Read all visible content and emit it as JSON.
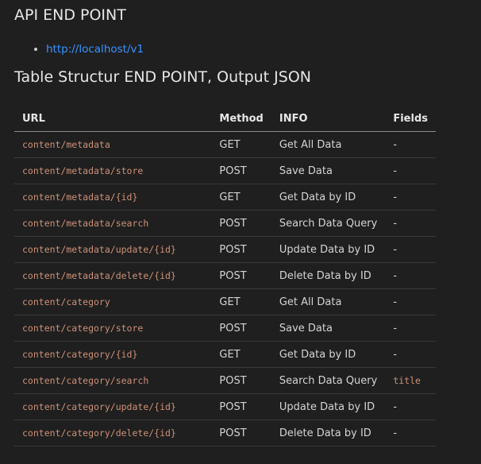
{
  "header": {
    "title": "API END POINT"
  },
  "links": [
    {
      "label": "http://localhost/v1"
    }
  ],
  "section": {
    "title": "Table Structur END POINT, Output JSON"
  },
  "table": {
    "headers": {
      "url": "URL",
      "method": "Method",
      "info": "INFO",
      "fields": "Fields"
    },
    "rows": [
      {
        "url": "content/metadata",
        "method": "GET",
        "info": "Get All Data",
        "fields": "-",
        "fields_code": false
      },
      {
        "url": "content/metadata/store",
        "method": "POST",
        "info": "Save Data",
        "fields": "-",
        "fields_code": false
      },
      {
        "url": "content/metadata/{id}",
        "method": "GET",
        "info": "Get Data by ID",
        "fields": "-",
        "fields_code": false
      },
      {
        "url": "content/metadata/search",
        "method": "POST",
        "info": "Search Data Query",
        "fields": "-",
        "fields_code": false
      },
      {
        "url": "content/metadata/update/{id}",
        "method": "POST",
        "info": "Update Data by ID",
        "fields": "-",
        "fields_code": false
      },
      {
        "url": "content/metadata/delete/{id}",
        "method": "POST",
        "info": "Delete Data by ID",
        "fields": "-",
        "fields_code": false
      },
      {
        "url": "content/category",
        "method": "GET",
        "info": "Get All Data",
        "fields": "-",
        "fields_code": false
      },
      {
        "url": "content/category/store",
        "method": "POST",
        "info": "Save Data",
        "fields": "-",
        "fields_code": false
      },
      {
        "url": "content/category/{id}",
        "method": "GET",
        "info": "Get Data by ID",
        "fields": "-",
        "fields_code": false
      },
      {
        "url": "content/category/search",
        "method": "POST",
        "info": "Search Data Query",
        "fields": "title",
        "fields_code": true
      },
      {
        "url": "content/category/update/{id}",
        "method": "POST",
        "info": "Update Data by ID",
        "fields": "-",
        "fields_code": false
      },
      {
        "url": "content/category/delete/{id}",
        "method": "POST",
        "info": "Delete Data by ID",
        "fields": "-",
        "fields_code": false
      }
    ]
  }
}
